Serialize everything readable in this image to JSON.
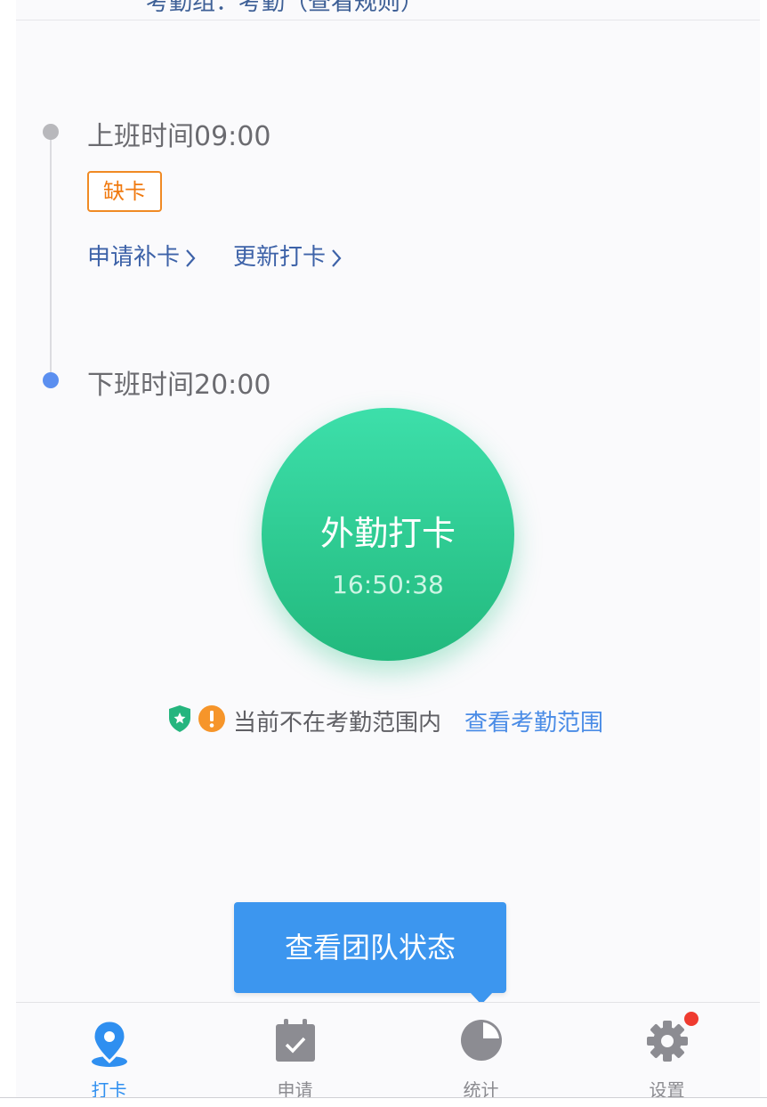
{
  "header": {
    "partial_text": "考勤组：考勤（查看规则）"
  },
  "timeline": {
    "start": {
      "label": "上班时间09:00",
      "badge": "缺卡"
    },
    "actions": [
      {
        "label": "申请补卡"
      },
      {
        "label": "更新打卡"
      }
    ],
    "end": {
      "label": "下班时间20:00"
    }
  },
  "punch": {
    "title": "外勤打卡",
    "time": "16:50:38"
  },
  "status": {
    "text": "当前不在考勤范围内",
    "link": "查看考勤范围"
  },
  "tooltip": {
    "text": "查看团队状态"
  },
  "tabs": [
    {
      "label": "打卡",
      "icon": "location-pin-icon",
      "active": true
    },
    {
      "label": "申请",
      "icon": "calendar-check-icon",
      "active": false
    },
    {
      "label": "统计",
      "icon": "pie-chart-icon",
      "active": false
    },
    {
      "label": "设置",
      "icon": "gear-icon",
      "active": false,
      "has_notification": true
    }
  ],
  "colors": {
    "accent_blue": "#3c96ef",
    "punch_green": "#2ccf92",
    "warning_orange": "#f08a24",
    "notification_red": "#ef3b30"
  }
}
